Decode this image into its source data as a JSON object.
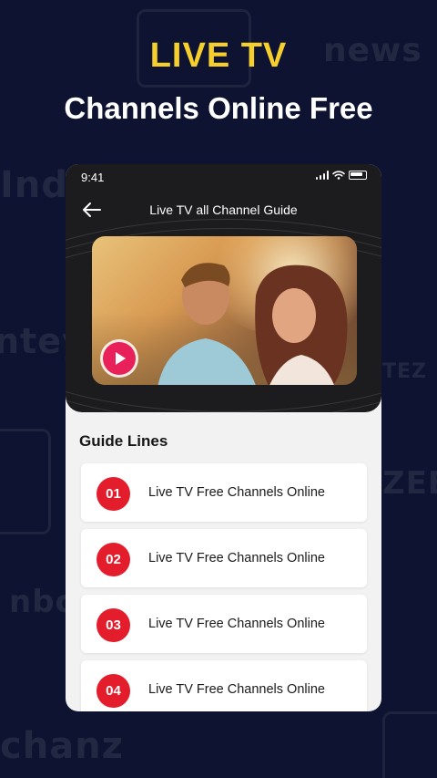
{
  "banner": {
    "title": "LIVE TV",
    "subtitle": "Channels Online Free"
  },
  "background_logos": [
    "news",
    "India",
    "ntey",
    "TEZ",
    "ZEE",
    "nbc",
    "chanz"
  ],
  "status_bar": {
    "time": "9:41",
    "icons": [
      "signal-icon",
      "wifi-icon",
      "battery-icon"
    ]
  },
  "nav": {
    "back_icon": "arrow-left-icon",
    "title": "Live TV all Channel Guide"
  },
  "video": {
    "play_icon": "play-icon"
  },
  "guide": {
    "heading": "Guide Lines",
    "items": [
      {
        "number": "01",
        "label": "Live TV Free Channels Online"
      },
      {
        "number": "02",
        "label": "Live TV Free Channels Online"
      },
      {
        "number": "03",
        "label": "Live TV Free Channels Online"
      },
      {
        "number": "04",
        "label": "Live TV Free Channels Online"
      }
    ]
  },
  "colors": {
    "background": "#0d1330",
    "title_yellow": "#f6cf2d",
    "badge_red": "#e31d2b",
    "play_pink": "#e8215a",
    "header_dark": "#1c1c1e"
  }
}
